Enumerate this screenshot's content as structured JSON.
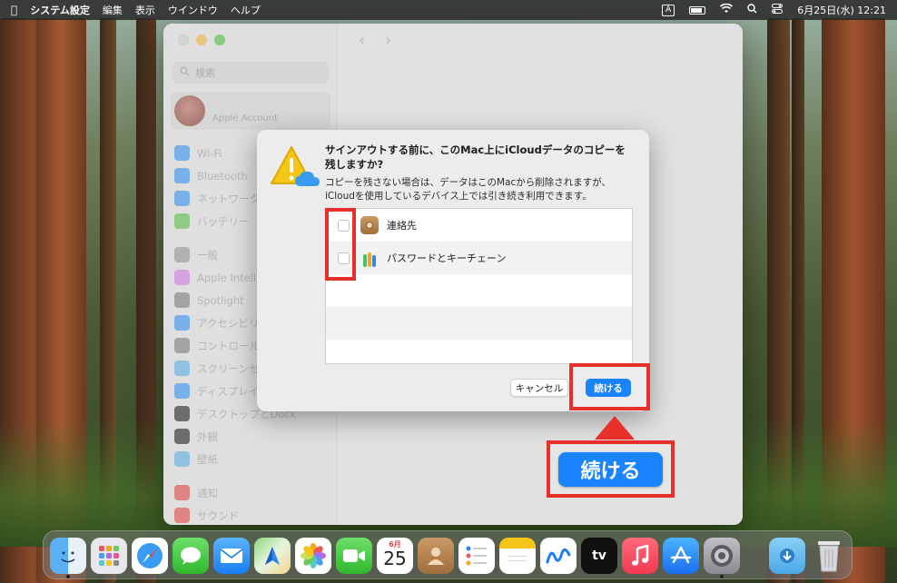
{
  "menubar": {
    "app_name": "システム設定",
    "menus": [
      "編集",
      "表示",
      "ウインドウ",
      "ヘルプ"
    ],
    "input_mode": "A",
    "datetime": "6月25日(水)  12:21"
  },
  "sidebar": {
    "search_placeholder": "検索",
    "account_label": "Apple Account",
    "items": [
      {
        "label": "Wi-Fi",
        "icon": "wifi-icon",
        "color": "#4a9ef5"
      },
      {
        "label": "Bluetooth",
        "icon": "bluetooth-icon",
        "color": "#4a9ef5"
      },
      {
        "label": "ネットワーク",
        "icon": "globe-icon",
        "color": "#4a9ef5"
      },
      {
        "label": "バッテリー",
        "icon": "battery-icon",
        "color": "#6cc85a"
      },
      {
        "label": "一般",
        "icon": "gear-icon",
        "color": "#a0a0a0"
      },
      {
        "label": "Apple Intelligence と Siri",
        "icon": "siri-icon",
        "color": "#d78ae8"
      },
      {
        "label": "Spotlight",
        "icon": "spotlight-icon",
        "color": "#8a8a8a"
      },
      {
        "label": "アクセシビリティ",
        "icon": "accessibility-icon",
        "color": "#4a9ef5"
      },
      {
        "label": "コントロールセンター",
        "icon": "control-center-icon",
        "color": "#8a8a8a"
      },
      {
        "label": "スクリーンセーバ",
        "icon": "screensaver-icon",
        "color": "#6cb8e8"
      },
      {
        "label": "ディスプレイ",
        "icon": "display-icon",
        "color": "#4a9ef5"
      },
      {
        "label": "デスクトップとDock",
        "icon": "dock-icon",
        "color": "#3a3a3a"
      },
      {
        "label": "外観",
        "icon": "appearance-icon",
        "color": "#3a3a3a"
      },
      {
        "label": "壁紙",
        "icon": "wallpaper-icon",
        "color": "#6cb8e8"
      },
      {
        "label": "通知",
        "icon": "notifications-icon",
        "color": "#e85a5a"
      },
      {
        "label": "サウンド",
        "icon": "sound-icon",
        "color": "#e85a5a"
      }
    ]
  },
  "dialog": {
    "title": "サインアウトする前に、このMac上にiCloudデータのコピーを残しますか?",
    "message": "コピーを残さない場合は、データはこのMacから削除されますが、iCloudを使用しているデバイス上では引き続き利用できます。",
    "items": [
      {
        "label": "連絡先",
        "checked": false
      },
      {
        "label": "パスワードとキーチェーン",
        "checked": false
      }
    ],
    "cancel_label": "キャンセル",
    "continue_label": "続ける"
  },
  "callout": {
    "label": "続ける"
  },
  "dock": {
    "calendar_month": "6月",
    "calendar_day": "25",
    "tv_label": "tv",
    "apps": [
      "Finder",
      "Launchpad",
      "Safari",
      "メッセージ",
      "メール",
      "マップ",
      "写真",
      "FaceTime",
      "カレンダー",
      "連絡先",
      "リマインダー",
      "メモ",
      "フリーボード",
      "TV",
      "ミュージック",
      "App Store",
      "システム設定",
      "ダウンロード",
      "ゴミ箱"
    ]
  }
}
